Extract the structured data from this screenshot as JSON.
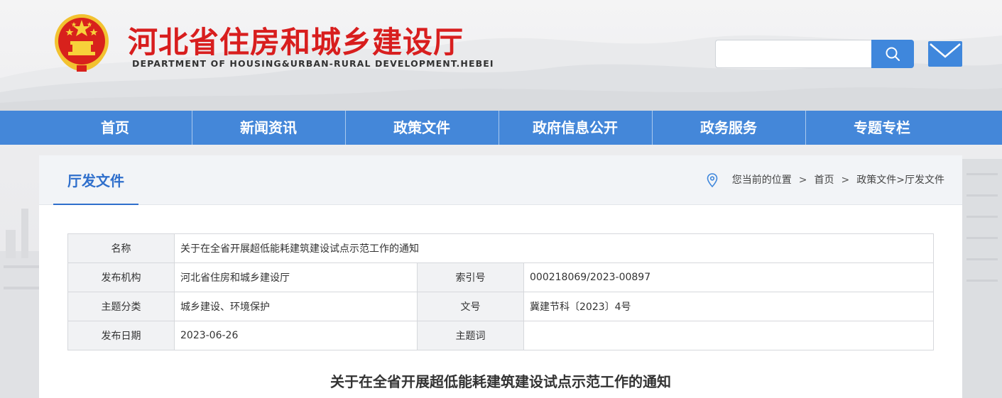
{
  "header": {
    "site_title": "河北省住房和城乡建设厅",
    "site_subtitle": "DEPARTMENT OF HOUSING&URBAN-RURAL DEVELOPMENT.HEBEI",
    "search_placeholder": "",
    "colors": {
      "title_red": "#d81e1e",
      "accent_blue": "#4487d9"
    }
  },
  "nav": {
    "items": [
      "首页",
      "新闻资讯",
      "政策文件",
      "政府信息公开",
      "政务服务",
      "专题专栏"
    ]
  },
  "section": {
    "tab_label": "厅发文件",
    "breadcrumb": {
      "prefix": "您当前的位置",
      "sep": ">",
      "home": "首页",
      "path": "政策文件>厅发文件"
    }
  },
  "meta": {
    "name_label": "名称",
    "name_value": "关于在全省开展超低能耗建筑建设试点示范工作的通知",
    "publisher_label": "发布机构",
    "publisher_value": "河北省住房和城乡建设厅",
    "index_label": "索引号",
    "index_value": "000218069/2023-00897",
    "topic_label": "主题分类",
    "topic_value": "城乡建设、环境保护",
    "docno_label": "文号",
    "docno_value": "冀建节科〔2023〕4号",
    "date_label": "发布日期",
    "date_value": "2023-06-26",
    "keyword_label": "主题词",
    "keyword_value": ""
  },
  "document": {
    "title": "关于在全省开展超低能耗建筑建设试点示范工作的通知"
  }
}
